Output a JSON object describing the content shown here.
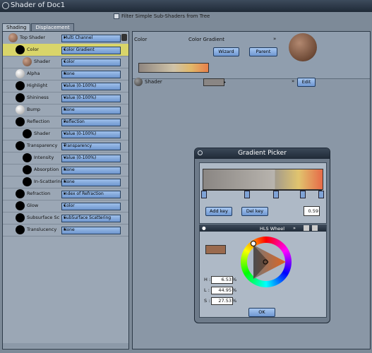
{
  "window": {
    "title": "Shader of Doc1"
  },
  "filter": {
    "label": "Filter Simple Sub-Shaders from Tree"
  },
  "tabs": [
    "Shading",
    "Displacement"
  ],
  "tree": [
    {
      "label": "Top Shader",
      "value": "Multi Channel",
      "icon": "sphere-brown-icon"
    },
    {
      "label": "Color",
      "value": "Color Gradient",
      "icon": "black-ball-icon"
    },
    {
      "label": "Shader",
      "value": "Color",
      "icon": "sphere-brown-icon"
    },
    {
      "label": "Alpha",
      "value": "None",
      "icon": "white-ball-icon"
    },
    {
      "label": "Highlight",
      "value": "Value (0-100%)",
      "icon": "black-ball-icon"
    },
    {
      "label": "Shininess",
      "value": "Value (0-100%)",
      "icon": "black-ball-icon"
    },
    {
      "label": "Bump",
      "value": "None",
      "icon": "white-ball-icon"
    },
    {
      "label": "Reflection",
      "value": "Reflection",
      "icon": "black-ball-icon"
    },
    {
      "label": "Shader",
      "value": "Value (0-100%)",
      "icon": "black-ball-icon"
    },
    {
      "label": "Transparency",
      "value": "Transparency",
      "icon": "black-ball-icon"
    },
    {
      "label": "Intensity",
      "value": "Value (0-100%)",
      "icon": "black-ball-icon"
    },
    {
      "label": "Absorption",
      "value": "None",
      "icon": "black-ball-icon"
    },
    {
      "label": "In-Scattering",
      "value": "None",
      "icon": "black-ball-icon"
    },
    {
      "label": "Refraction",
      "value": "Index of Refraction",
      "icon": "black-ball-icon"
    },
    {
      "label": "Glow",
      "value": "Color",
      "icon": "black-ball-icon"
    },
    {
      "label": "Subsurface Sc",
      "value": "SubSurface Scattering",
      "icon": "black-ball-icon"
    },
    {
      "label": "Translucency",
      "value": "None",
      "icon": "black-ball-icon"
    }
  ],
  "right": {
    "header_label": "Color",
    "header_value": "Color Gradient",
    "wizard": "Wizard",
    "parent": "Parent",
    "shader_label": "Shader",
    "edit": "Edit"
  },
  "picker": {
    "title": "Gradient Picker",
    "add_key": "Add key",
    "del_key": "Del key",
    "position": "0.59",
    "mode": "HLS Wheel",
    "h_label": "H :",
    "h_value": "6.53",
    "l_label": "L :",
    "l_value": "44.95",
    "s_label": "S :",
    "s_value": "27.53",
    "unit": "%",
    "ok": "OK"
  },
  "colors": {
    "accent": "#d9d56a",
    "swatch": "#9a6a4e"
  }
}
